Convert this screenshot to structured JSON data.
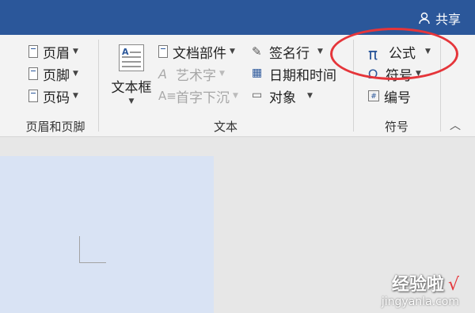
{
  "titlebar": {
    "share_label": "共享"
  },
  "groups": {
    "header_footer": {
      "label": "页眉和页脚",
      "items": [
        "页眉",
        "页脚",
        "页码"
      ]
    },
    "text": {
      "label": "文本",
      "textbox_label": "文本框",
      "col2": [
        "文档部件",
        "艺术字",
        "首字下沉"
      ],
      "col3": [
        "签名行",
        "日期和时间",
        "对象"
      ]
    },
    "symbols": {
      "label": "符号",
      "equation": "公式",
      "symbol": "符号",
      "number": "编号"
    }
  },
  "watermark": {
    "text": "经验啦",
    "check": "√",
    "url": "jingyanla.com"
  },
  "colors": {
    "titlebar": "#2b579a",
    "highlight": "#e5353a",
    "page": "#d9e3f4"
  }
}
